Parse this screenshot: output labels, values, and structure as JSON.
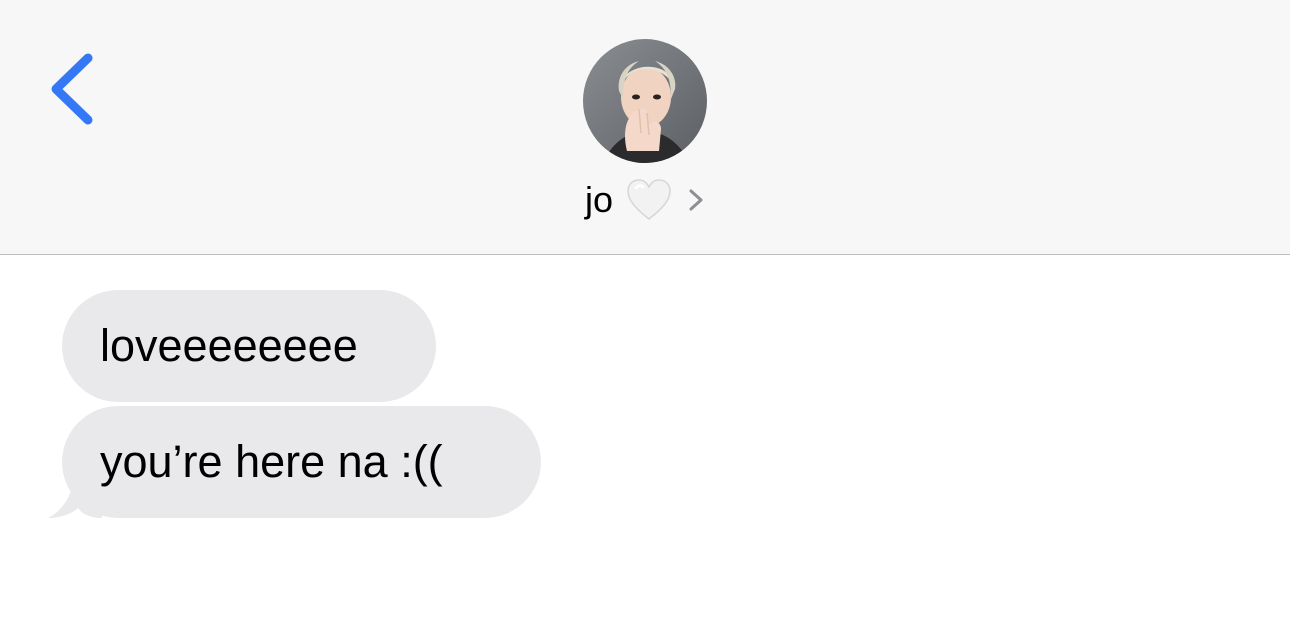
{
  "header": {
    "back_icon": "chevron-left-icon",
    "contact": {
      "name": "jo",
      "emoji_icon": "white-heart-icon",
      "disclosure_icon": "chevron-right-icon"
    }
  },
  "messages": [
    {
      "direction": "incoming",
      "text": "loveeeeeeee"
    },
    {
      "direction": "incoming",
      "text": "you’re here na :(("
    }
  ],
  "colors": {
    "accent": "#3478f6",
    "header_background": "#f7f7f8",
    "incoming_bubble": "#e9e9eb",
    "divider": "#bdbdc1"
  }
}
